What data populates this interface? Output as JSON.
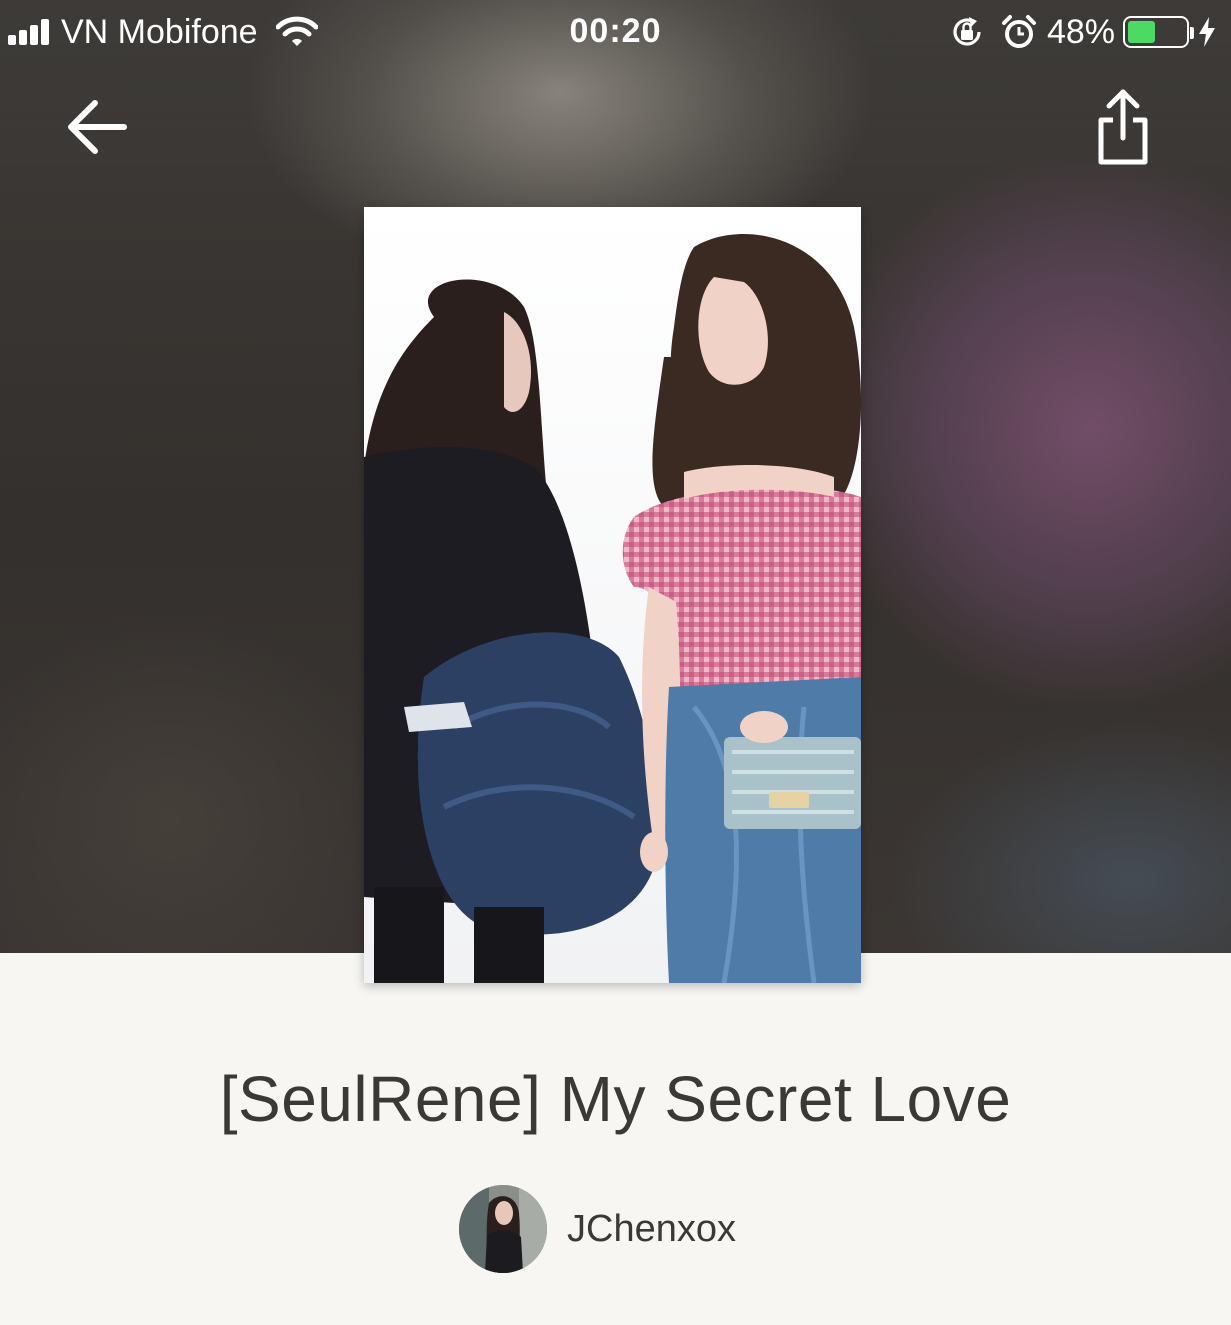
{
  "status_bar": {
    "carrier": "VN Mobifone",
    "time": "00:20",
    "battery_percent": "48%",
    "battery_level": 0.48,
    "icons": [
      "signal-icon",
      "wifi-icon",
      "rotation-lock-icon",
      "alarm-icon",
      "battery-icon",
      "charging-icon"
    ]
  },
  "nav": {
    "back_icon": "back-arrow-icon",
    "share_icon": "share-icon"
  },
  "story": {
    "title": "[SeulRene] My Secret Love",
    "author": "JChenxox"
  },
  "colors": {
    "battery_fill": "#4cd964",
    "page_background": "#f7f6f2",
    "title_text": "#3b3936"
  }
}
